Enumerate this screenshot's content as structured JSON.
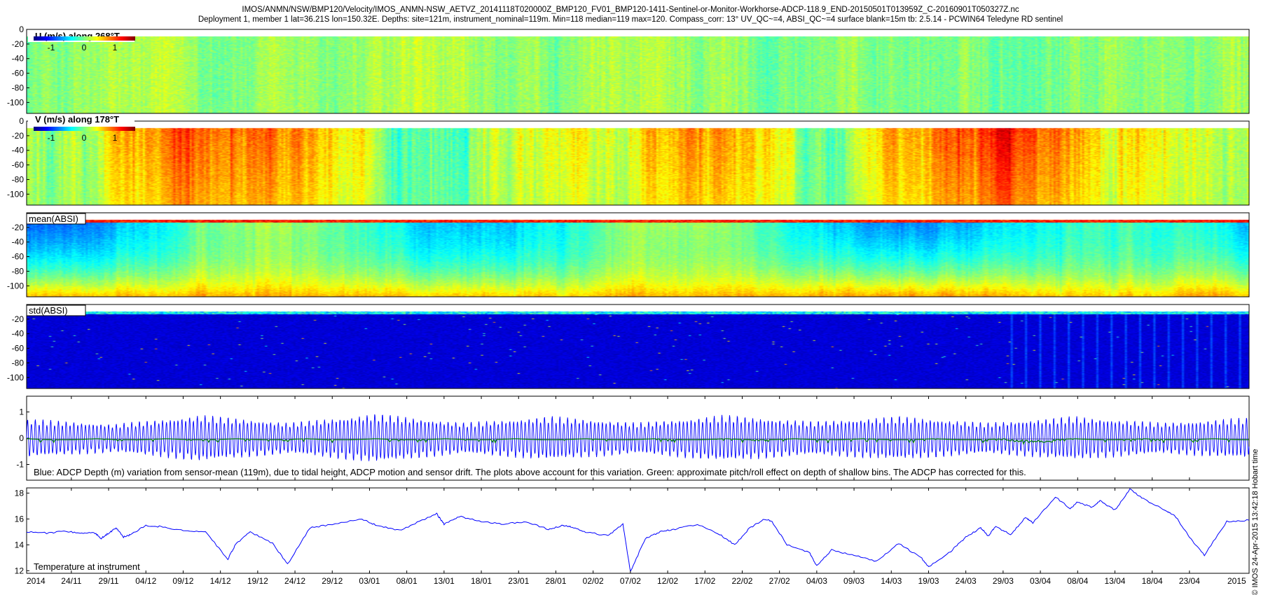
{
  "header": {
    "line1": "IMOS/ANMN/NSW/BMP120/Velocity/IMOS_ANMN-NSW_AETVZ_20141118T020000Z_BMP120_FV01_BMP120-1411-Sentinel-or-Monitor-Workhorse-ADCP-118.9_END-20150501T013959Z_C-20160901T050327Z.nc",
    "line2": "Deployment 1, member 1 lat=36.21S lon=150.32E. Depths: site=121m, instrument_nominal=119m. Min=118 median=119 max=120. Compass_corr: 13° UV_QC~=4, ABSI_QC~=4 surface blank=15m tb: 2.5.14 - PCWIN64 Teledyne RD sentinel"
  },
  "side_label": "© IMOS 24-Apr-2015 13:42:18 Hobart time",
  "colors": {
    "line_blue": "#0000ff",
    "line_green": "#008000",
    "jet_low": "#00008f",
    "jet_high": "#800000"
  },
  "chart_data": [
    {
      "type": "heatmap",
      "label": "U (m/s) along 268°T",
      "colorbar_ticks": [
        "-1",
        "0",
        "1"
      ],
      "colorbar_range": [
        -1.5,
        1.5
      ],
      "y_ticks": [
        "0",
        "-20",
        "-40",
        "-60",
        "-80",
        "-100"
      ],
      "ylim": [
        -115,
        0
      ],
      "pattern": "mostly-near-zero",
      "segment_means": [
        0.0,
        0.05,
        0.1,
        0.05,
        0.0,
        0.05,
        0.1,
        0.0,
        -0.05,
        0.05,
        0.1,
        0.05,
        0.0,
        0.05,
        0.0,
        -0.05,
        0.05,
        0.1,
        0.0,
        0.05
      ]
    },
    {
      "type": "heatmap",
      "label": "V (m/s) along 178°T",
      "colorbar_ticks": [
        "-1",
        "0",
        "1"
      ],
      "colorbar_range": [
        -1.5,
        1.5
      ],
      "y_ticks": [
        "0",
        "-20",
        "-40",
        "-60",
        "-80",
        "-100"
      ],
      "ylim": [
        -115,
        0
      ],
      "pattern": "alongshore",
      "segment_means": [
        0.1,
        0.2,
        0.6,
        0.85,
        0.9,
        0.7,
        0.5,
        0.2,
        -0.1,
        0.0,
        0.3,
        0.25,
        0.4,
        0.7,
        0.6,
        0.3,
        -0.2,
        0.4,
        0.9,
        1.0,
        0.8,
        0.6,
        0.5,
        0.3,
        0.1
      ]
    },
    {
      "type": "heatmap",
      "label": "mean(ABSI)",
      "y_ticks": [
        "-20",
        "-40",
        "-60",
        "-80",
        "-100"
      ],
      "ylim": [
        -115,
        0
      ],
      "pattern": "absi-mean"
    },
    {
      "type": "heatmap",
      "label": "std(ABSI)",
      "y_ticks": [
        "-20",
        "-40",
        "-60",
        "-80",
        "-100"
      ],
      "ylim": [
        -115,
        0
      ],
      "pattern": "absi-std"
    },
    {
      "type": "line",
      "caption": "Blue: ADCP Depth (m) variation from sensor-mean (119m), due to tidal height, ADCP motion and sensor drift. The plots above account for this variation. Green: approximate pitch/roll effect on depth of shallow bins. The ADCP has corrected for this.",
      "y_ticks": [
        "1",
        "0",
        "-1"
      ],
      "ylim": [
        -1.6,
        1.6
      ],
      "series": [
        {
          "name": "Blue",
          "pattern": "tidal",
          "amplitude_envelope": [
            0.75,
            0.55,
            0.9,
            0.6,
            0.95,
            0.6,
            0.85,
            0.6,
            0.9,
            0.65,
            0.85,
            0.6,
            0.85,
            0.6,
            0.8
          ]
        },
        {
          "name": "Green",
          "pattern": "pitch-roll"
        }
      ]
    },
    {
      "type": "line",
      "label": "Temperature at instrument",
      "y_ticks": [
        "18",
        "16",
        "14",
        "12"
      ],
      "ylim": [
        11.8,
        18.4
      ],
      "days_since_start": [
        0,
        3,
        5,
        7,
        9,
        10,
        11,
        12,
        13,
        14,
        16,
        18,
        21,
        24,
        27,
        28,
        30,
        33,
        35,
        38,
        41,
        45,
        47,
        50,
        53,
        55,
        56,
        58,
        61,
        64,
        67,
        70,
        72,
        73,
        75,
        78,
        80,
        81,
        83,
        85,
        87,
        90,
        93,
        95,
        97,
        99,
        100,
        102,
        105,
        106,
        108,
        111,
        114,
        117,
        120,
        121,
        124,
        126,
        128,
        129,
        130,
        132,
        134,
        135,
        138,
        140,
        141,
        143,
        144,
        146,
        148,
        150,
        153,
        154,
        156,
        158,
        161,
        164
      ],
      "values": [
        15.0,
        14.9,
        15.1,
        14.9,
        15.0,
        14.5,
        14.9,
        15.3,
        14.6,
        14.8,
        15.5,
        15.4,
        15.1,
        15.0,
        12.9,
        14.0,
        15.0,
        14.1,
        12.5,
        15.3,
        15.6,
        16.0,
        15.5,
        15.1,
        15.9,
        16.4,
        15.6,
        16.2,
        15.8,
        15.6,
        15.8,
        15.2,
        15.5,
        15.4,
        15.0,
        14.7,
        15.6,
        11.9,
        14.5,
        15.0,
        15.2,
        15.6,
        14.8,
        14.0,
        15.3,
        16.0,
        15.8,
        14.0,
        13.4,
        12.4,
        13.6,
        13.2,
        12.7,
        14.1,
        13.0,
        12.3,
        13.5,
        14.6,
        15.3,
        14.7,
        15.4,
        14.8,
        16.1,
        15.7,
        17.7,
        16.8,
        17.3,
        16.9,
        17.4,
        16.7,
        18.3,
        17.5,
        16.6,
        16.3,
        14.6,
        13.2,
        15.8,
        15.9
      ],
      "series": [
        {
          "name": "Temperature at instrument"
        }
      ]
    }
  ],
  "x_axis": {
    "year_left": "2014",
    "year_right": "2015",
    "date_labels": [
      "24/11",
      "29/11",
      "04/12",
      "09/12",
      "14/12",
      "19/12",
      "24/12",
      "29/12",
      "03/01",
      "08/01",
      "13/01",
      "18/01",
      "23/01",
      "28/01",
      "02/02",
      "07/02",
      "12/02",
      "17/02",
      "22/02",
      "27/02",
      "04/03",
      "09/03",
      "14/03",
      "19/03",
      "24/03",
      "29/03",
      "03/04",
      "08/04",
      "13/04",
      "18/04",
      "23/04"
    ],
    "range_days": [
      0,
      164
    ]
  }
}
